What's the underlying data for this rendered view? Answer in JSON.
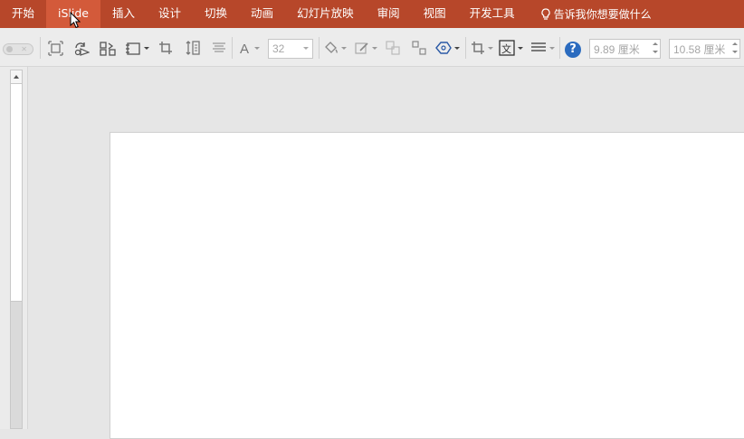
{
  "ribbon": {
    "tabs": [
      {
        "label": "开始"
      },
      {
        "label": "iSlide"
      },
      {
        "label": "插入"
      },
      {
        "label": "设计"
      },
      {
        "label": "切换"
      },
      {
        "label": "动画"
      },
      {
        "label": "幻灯片放映"
      },
      {
        "label": "审阅"
      },
      {
        "label": "视图"
      },
      {
        "label": "开发工具"
      }
    ],
    "active_tab": "iSlide",
    "tell_me": "告诉我你想要做什么",
    "colors": {
      "ribbon_bg": "#b7472a",
      "active_tab_bg": "#d35a3a"
    }
  },
  "toolbar": {
    "font_size": "32",
    "width_value": "9.89 厘米",
    "height_value": "10.58 厘米",
    "help_glyph": "?",
    "icons": [
      "toggle-switch-icon",
      "align-frame-icon",
      "rotate-shape-icon",
      "distribute-icon",
      "layout-box-icon",
      "crop-icon",
      "text-spacing-icon",
      "text-align-icon",
      "font-color-icon",
      "fill-color-icon",
      "line-color-icon",
      "group-icon",
      "ungroup-icon",
      "shape-edit-icon",
      "crop-tool-icon",
      "text-box-icon",
      "line-style-icon",
      "help-icon"
    ]
  }
}
